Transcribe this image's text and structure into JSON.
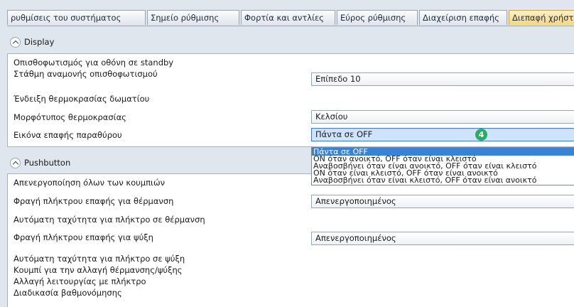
{
  "tabs": [
    "ρυθμίσεις του συστήματος",
    "Σημείο ρύθμισης",
    "Φορτία και αντλίες",
    "Εύρος ρύθμισης",
    "Διαχείριση επαφής",
    "Διεπαφή χρήστη"
  ],
  "display": {
    "title": "Display",
    "rows": [
      "Οπισθοφωτισμός για οθόνη σε standby",
      "Στάθμη αναμονής οπισθοφωτισμού",
      "Ένδειξη θερμοκρασίας δωματίου",
      "Μορφότυπος θερμοκρασίας",
      "Εικόνα επαφής παραθύρου"
    ],
    "backlight_level_value": "Επίπεδο 10",
    "temperature_format_value": "Κελσίου",
    "window_contact_value": "Πάντα σε OFF",
    "badge": "4"
  },
  "dropdown_options": [
    "Πάντα σε OFF",
    "ON όταν ανοικτό, OFF όταν είναι κλειστό",
    "Αναβοσβήνει όταν είναι ανοικτό, OFF όταν είναι κλειστό",
    "ON όταν είναι κλειστό, OFF όταν είναι ανοικτό",
    "Αναβοσβήνει όταν είναι κλειστό, OFF όταν είναι ανοικτό"
  ],
  "pushbutton": {
    "title": "Pushbutton",
    "rows": [
      "Απενεργοποίηση όλων των κουμπιών",
      "Φραγή πλήκτρου επαφής για θέρμανση",
      "Αυτόματη ταχύτητα για πλήκτρο σε θέρμανση",
      "Φραγή πλήκτρου επαφής για ψύξη",
      "Αυτόματη ταχύτητα για πλήκτρο σε ψύξη",
      "Κουμπί για την αλλαγή θέρμανσης/ψύξης",
      "Αλλαγή λειτουργίας με πλήκτρο",
      "Διαδικασία βαθμονόμησης"
    ],
    "heating_lock_value": "Απενεργοποιημένος",
    "cooling_lock_value": "Απενεργοποιημένος"
  },
  "colors": {
    "active_tab": "#f6d483",
    "focus": "#cfe3fb",
    "selection": "#3b82d6",
    "badge": "#27ae60"
  }
}
